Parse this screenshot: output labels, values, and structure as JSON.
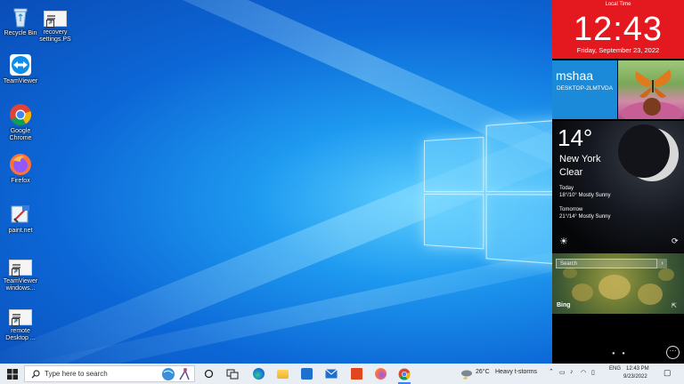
{
  "desktop": {
    "icons": [
      {
        "label": "Recycle Bin",
        "icon": "recycle-bin-icon"
      },
      {
        "label": "recovery settings.PS",
        "icon": "document-icon"
      },
      {
        "label": "TeamViewer",
        "icon": "teamviewer-icon"
      },
      {
        "label": "Google Chrome",
        "icon": "chrome-icon"
      },
      {
        "label": "Firefox",
        "icon": "firefox-icon"
      },
      {
        "label": "paint.net",
        "icon": "paintnet-icon"
      },
      {
        "label": "TeamViewer windows...",
        "icon": "document-icon"
      },
      {
        "label": "remote Desktop ...",
        "icon": "document-icon"
      }
    ]
  },
  "panel": {
    "clock": {
      "label": "Local Time",
      "time": "12:43",
      "date": "Friday, September 23, 2022"
    },
    "user": {
      "name": "mshaa",
      "computer": "DESKTOP-2LMTVDA"
    },
    "weather": {
      "temperature": "14°",
      "city": "New York",
      "condition": "Clear",
      "today_label": "Today",
      "today_forecast": "18°/10° Mostly Sunny",
      "tomorrow_label": "Tomorrow",
      "tomorrow_forecast": "21°/14° Mostly Sunny"
    },
    "bing": {
      "search_placeholder": "Search",
      "logo": "Bing"
    }
  },
  "taskbar": {
    "search_placeholder": "Type here to search",
    "weather_temp": "26°C",
    "weather_text": "Heavy t-storms",
    "language": "ENG",
    "clock_time": "12:43 PM",
    "clock_date": "9/23/2022",
    "apps": [
      "task-view-icon",
      "search-highlight-icon",
      "file-explorer-icon",
      "edge-icon",
      "folder-icon",
      "store-icon",
      "mail-icon",
      "office-icon",
      "firefox-icon",
      "chrome-icon"
    ]
  }
}
